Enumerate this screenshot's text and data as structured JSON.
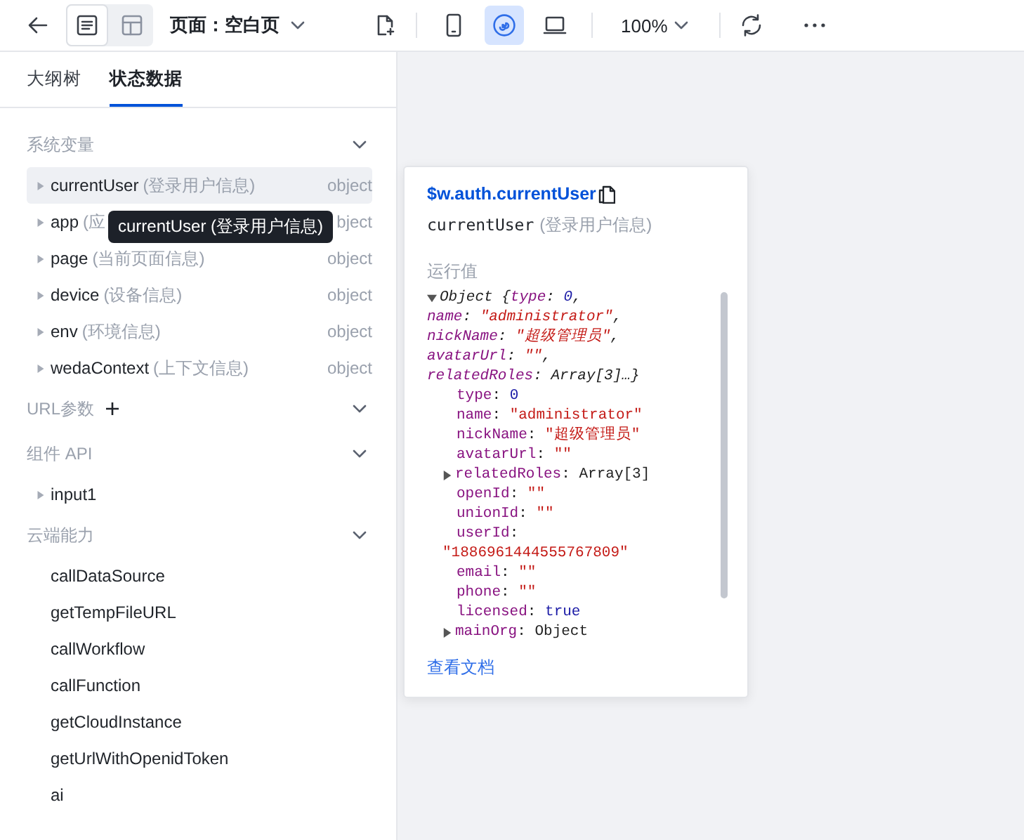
{
  "toolbar": {
    "view_modes": [
      {
        "kind": "outline",
        "selected": true
      },
      {
        "kind": "layout",
        "selected": false
      }
    ],
    "page_selector": "页面：空白页",
    "devices": [
      {
        "kind": "mobile",
        "selected": false
      },
      {
        "kind": "miniprogram",
        "selected": true
      },
      {
        "kind": "desktop",
        "selected": false
      }
    ],
    "zoom": "100%"
  },
  "tabs": [
    {
      "label": "大纲树",
      "selected": false
    },
    {
      "label": "状态数据",
      "selected": true
    }
  ],
  "sections": [
    {
      "title": "系统变量",
      "expanded": true,
      "addable": false,
      "items": [
        {
          "name": "currentUser",
          "description": "(登录用户信息)",
          "type": "object",
          "kind": "branch",
          "expanded": false,
          "selected": true
        },
        {
          "name": "app",
          "description": "(应",
          "type": "bject",
          "kind": "branch",
          "expanded": false,
          "selected": false
        },
        {
          "name": "page",
          "description": "(当前页面信息)",
          "type": "object",
          "kind": "branch",
          "expanded": false,
          "selected": false
        },
        {
          "name": "device",
          "description": "(设备信息)",
          "type": "object",
          "kind": "branch",
          "expanded": false,
          "selected": false
        },
        {
          "name": "env",
          "description": "(环境信息)",
          "type": "object",
          "kind": "branch",
          "expanded": false,
          "selected": false
        },
        {
          "name": "wedaContext",
          "description": "(上下文信息)",
          "type": "object",
          "kind": "branch",
          "expanded": false,
          "selected": false
        }
      ]
    },
    {
      "title": "URL参数",
      "expanded": true,
      "addable": true
    },
    {
      "title": "组件 API",
      "expanded": true,
      "addable": false,
      "items": [
        {
          "name": "input1",
          "kind": "branch",
          "expanded": false,
          "selected": false
        }
      ]
    },
    {
      "title": "云端能力",
      "expanded": true,
      "addable": false,
      "items": [
        {
          "name": "callDataSource",
          "kind": "leaf",
          "selected": false
        },
        {
          "name": "getTempFileURL",
          "kind": "leaf",
          "selected": false
        },
        {
          "name": "callWorkflow",
          "kind": "leaf",
          "selected": false
        },
        {
          "name": "callFunction",
          "kind": "leaf",
          "selected": false
        },
        {
          "name": "getCloudInstance",
          "kind": "leaf",
          "selected": false
        },
        {
          "name": "getUrlWithOpenidToken",
          "kind": "leaf",
          "selected": false
        },
        {
          "name": "ai",
          "kind": "leaf",
          "selected": false
        }
      ]
    }
  ],
  "tooltip": {
    "text": "currentUser (登录用户信息)"
  },
  "popover": {
    "path": "$w.auth.currentUser",
    "name": "currentUser",
    "description": "(登录用户信息)",
    "value_label": "运行值",
    "runtime_value": {
      "expanded": true,
      "summary": [
        [
          {
            "t": "Object {",
            "kind": "plain"
          },
          {
            "t": "type",
            "kind": "key"
          },
          {
            "t": ": ",
            "kind": "plain"
          },
          {
            "t": "0",
            "kind": "number"
          },
          {
            "t": ",",
            "kind": "plain"
          }
        ],
        [
          {
            "t": "name",
            "kind": "key"
          },
          {
            "t": ": ",
            "kind": "plain"
          },
          {
            "t": "\"administrator\"",
            "kind": "string"
          },
          {
            "t": ",",
            "kind": "plain"
          }
        ],
        [
          {
            "t": "nickName",
            "kind": "key"
          },
          {
            "t": ": ",
            "kind": "plain"
          },
          {
            "t": "\"超级管理员\"",
            "kind": "string"
          },
          {
            "t": ",",
            "kind": "plain"
          }
        ],
        [
          {
            "t": "avatarUrl",
            "kind": "key"
          },
          {
            "t": ": ",
            "kind": "plain"
          },
          {
            "t": "\"\"",
            "kind": "string"
          },
          {
            "t": ",",
            "kind": "plain"
          }
        ],
        [
          {
            "t": "relatedRoles",
            "kind": "key"
          },
          {
            "t": ": ",
            "kind": "plain"
          },
          {
            "t": "Array[3]…}",
            "kind": "plain"
          }
        ]
      ],
      "children": [
        {
          "kind": "leaf",
          "tokens": [
            {
              "t": "type",
              "kind": "key"
            },
            {
              "t": ": ",
              "kind": "plain"
            },
            {
              "t": "0",
              "kind": "number"
            }
          ]
        },
        {
          "kind": "leaf",
          "tokens": [
            {
              "t": "name",
              "kind": "key"
            },
            {
              "t": ": ",
              "kind": "plain"
            },
            {
              "t": "\"administrator\"",
              "kind": "string"
            }
          ]
        },
        {
          "kind": "leaf",
          "tokens": [
            {
              "t": "nickName",
              "kind": "key"
            },
            {
              "t": ": ",
              "kind": "plain"
            },
            {
              "t": "\"超级管理员\"",
              "kind": "string"
            }
          ]
        },
        {
          "kind": "leaf",
          "tokens": [
            {
              "t": "avatarUrl",
              "kind": "key"
            },
            {
              "t": ": ",
              "kind": "plain"
            },
            {
              "t": "\"\"",
              "kind": "string"
            }
          ]
        },
        {
          "kind": "branch",
          "expanded": false,
          "tokens": [
            {
              "t": "relatedRoles",
              "kind": "key"
            },
            {
              "t": ": ",
              "kind": "plain"
            },
            {
              "t": "Array[3]",
              "kind": "plain"
            }
          ]
        },
        {
          "kind": "leaf",
          "tokens": [
            {
              "t": "openId",
              "kind": "key"
            },
            {
              "t": ": ",
              "kind": "plain"
            },
            {
              "t": "\"\"",
              "kind": "string"
            }
          ]
        },
        {
          "kind": "leaf",
          "tokens": [
            {
              "t": "unionId",
              "kind": "key"
            },
            {
              "t": ": ",
              "kind": "plain"
            },
            {
              "t": "\"\"",
              "kind": "string"
            }
          ]
        },
        {
          "kind": "leaf",
          "tokens": [
            {
              "t": "userId",
              "kind": "key"
            },
            {
              "t": ": ",
              "kind": "plain"
            },
            {
              "t": "\"1886961444555767809\"",
              "kind": "string"
            }
          ]
        },
        {
          "kind": "leaf",
          "tokens": [
            {
              "t": "email",
              "kind": "key"
            },
            {
              "t": ": ",
              "kind": "plain"
            },
            {
              "t": "\"\"",
              "kind": "string"
            }
          ]
        },
        {
          "kind": "leaf",
          "tokens": [
            {
              "t": "phone",
              "kind": "key"
            },
            {
              "t": ": ",
              "kind": "plain"
            },
            {
              "t": "\"\"",
              "kind": "string"
            }
          ]
        },
        {
          "kind": "leaf",
          "tokens": [
            {
              "t": "licensed",
              "kind": "key"
            },
            {
              "t": ": ",
              "kind": "plain"
            },
            {
              "t": "true",
              "kind": "number"
            }
          ]
        },
        {
          "kind": "branch",
          "expanded": false,
          "tokens": [
            {
              "t": "mainOrg",
              "kind": "key"
            },
            {
              "t": ": ",
              "kind": "plain"
            },
            {
              "t": "Object",
              "kind": "plain"
            }
          ]
        }
      ]
    },
    "docs_link": "查看文档"
  }
}
